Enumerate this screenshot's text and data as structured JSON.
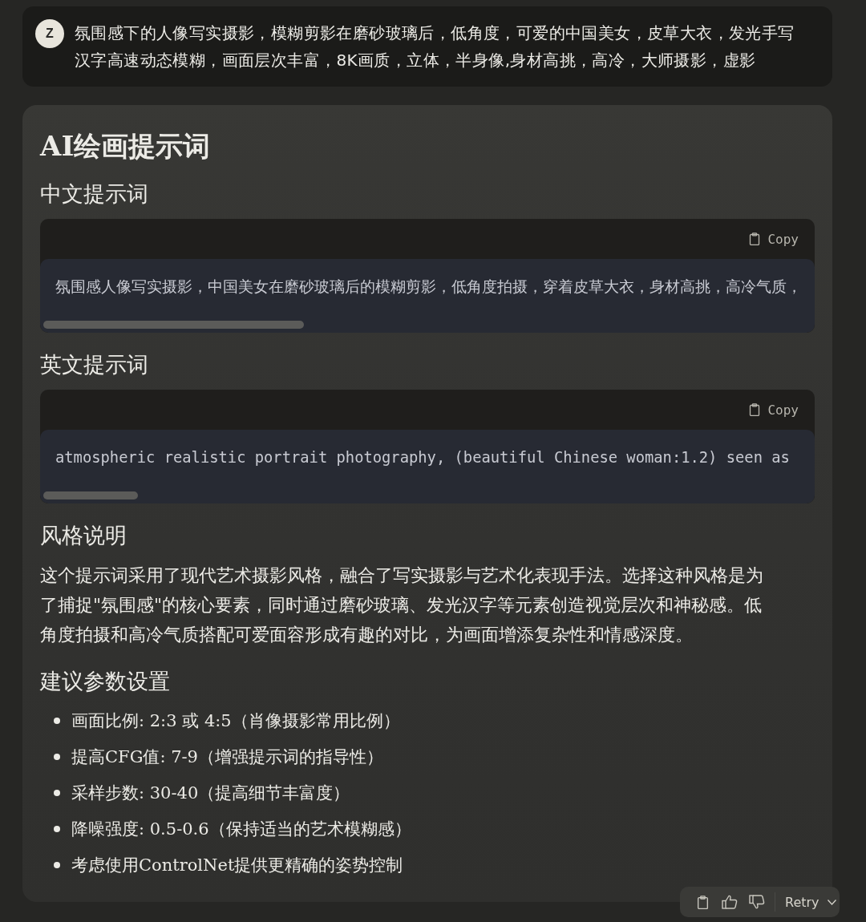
{
  "user_message": {
    "avatar": "Z",
    "text": "氛围感下的人像写实摄影，模糊剪影在磨砂玻璃后，低角度，可爱的中国美女，皮草大衣，发光手写汉字高速动态模糊，画面层次丰富，8K画质，立体，半身像,身材高挑，高冷，大师摄影，虚影"
  },
  "response": {
    "title": "AI绘画提示词",
    "sections": [
      {
        "kind": "code",
        "heading": "中文提示词",
        "copy_label": "Copy",
        "code": "氛围感人像写实摄影，中国美女在磨砂玻璃后的模糊剪影，低角度拍摄，穿着皮草大衣，身材高挑，高冷气质，"
      },
      {
        "kind": "code",
        "heading": "英文提示词",
        "copy_label": "Copy",
        "code": "atmospheric realistic portrait photography, (beautiful Chinese woman:1.2) seen as"
      },
      {
        "kind": "paragraph",
        "heading": "风格说明",
        "text": "这个提示词采用了现代艺术摄影风格，融合了写实摄影与艺术化表现手法。选择这种风格是为了捕捉\"氛围感\"的核心要素，同时通过磨砂玻璃、发光汉字等元素创造视觉层次和神秘感。低角度拍摄和高冷气质搭配可爱面容形成有趣的对比，为画面增添复杂性和情感深度。"
      },
      {
        "kind": "list",
        "heading": "建议参数设置",
        "items": [
          "画面比例: 2:3 或 4:5（肖像摄影常用比例）",
          "提高CFG值: 7-9（增强提示词的指导性）",
          "采样步数: 30-40（提高细节丰富度）",
          "降噪强度: 0.5-0.6（保持适当的艺术模糊感）",
          "考虑使用ControlNet提供更精确的姿势控制"
        ]
      }
    ]
  },
  "actions": {
    "retry_label": "Retry"
  }
}
